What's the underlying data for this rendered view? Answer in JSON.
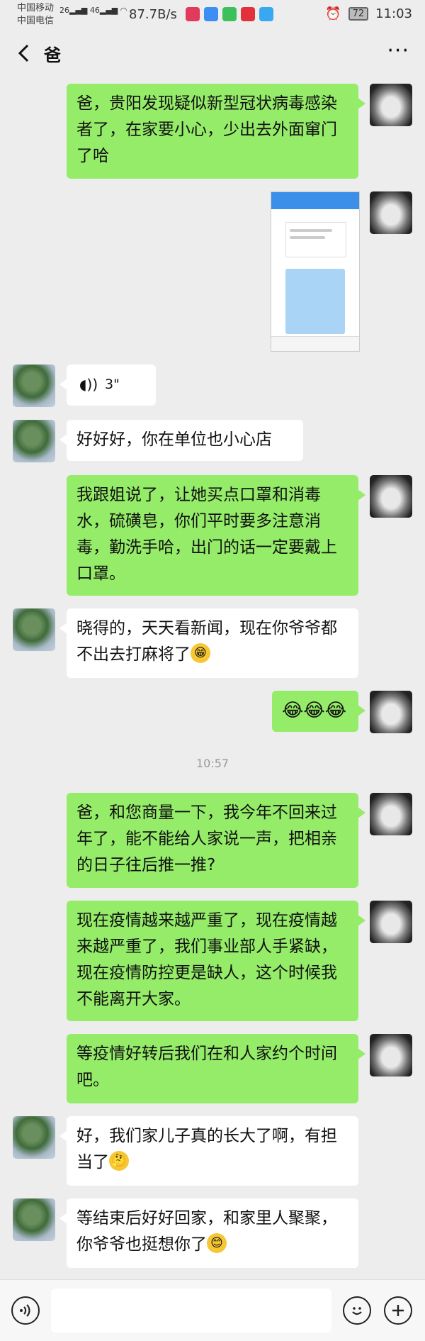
{
  "status": {
    "carrier1": "中国移动",
    "carrier2": "中国电信",
    "net1": "26",
    "net2": "46",
    "speed": "87.7B/s",
    "battery": "72",
    "time": "11:03"
  },
  "header": {
    "back_icon": "chevron-left-icon",
    "title": "爸",
    "more_icon": "more-dots-icon",
    "more": "···"
  },
  "messages": [
    {
      "side": "me",
      "text": "爸，贵阳发现疑似新型冠状病毒感染者了，在家要小心，少出去外面窜门了哈"
    },
    {
      "side": "me",
      "type": "image"
    },
    {
      "side": "other",
      "type": "voice",
      "duration": "3\""
    },
    {
      "side": "other",
      "text": "好好好，你在单位也小心店"
    },
    {
      "side": "me",
      "text": "我跟姐说了，让她买点口罩和消毒水，硫磺皂，你们平时要多注意消毒，勤洗手哈，出门的话一定要戴上口罩。"
    },
    {
      "side": "other",
      "text": "晓得的，天天看新闻，现在你爷爷都不出去打麻将了",
      "emoji": "😁"
    },
    {
      "side": "me",
      "emoji": "😂😂😂"
    },
    {
      "type": "time",
      "text": "10:57"
    },
    {
      "side": "me",
      "text": "爸，和您商量一下，我今年不回来过年了，能不能给人家说一声，把相亲的日子往后推一推?"
    },
    {
      "side": "me",
      "text": "现在疫情越来越严重了，现在疫情越来越严重了，我们事业部人手紧缺，现在疫情防控更是缺人，这个时候我不能离开大家。"
    },
    {
      "side": "me",
      "text": "等疫情好转后我们在和人家约个时间吧。"
    },
    {
      "side": "other",
      "text": "好，我们家儿子真的长大了啊，有担当了",
      "emoji": "🤔"
    },
    {
      "side": "other",
      "text": "等结束后好好回家，和家里人聚聚，你爷爷也挺想你了",
      "emoji": "😊"
    }
  ],
  "bottom": {
    "voice_icon": "voice-input-icon",
    "emoji_icon": "emoji-icon",
    "plus_icon": "plus-icon"
  },
  "colors": {
    "me_bubble": "#95ec69",
    "other_bubble": "#ffffff",
    "background": "#ededed"
  }
}
